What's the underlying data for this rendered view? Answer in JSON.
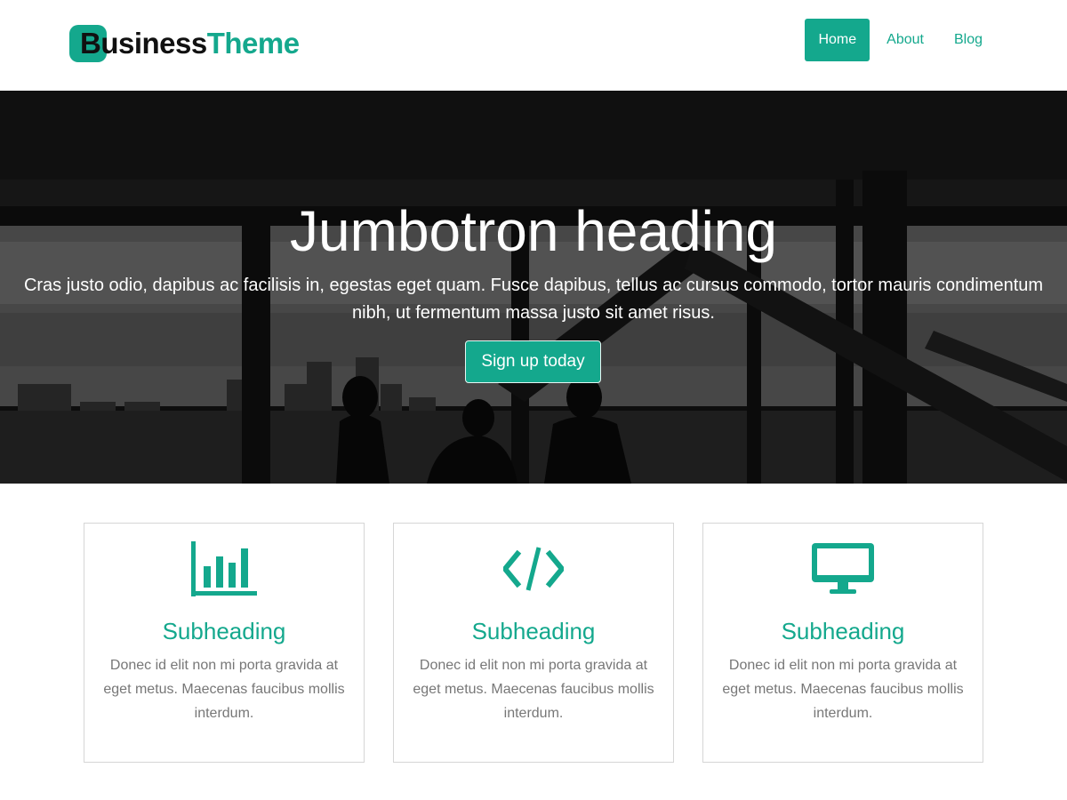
{
  "header": {
    "logo": {
      "part1": "Business",
      "part2": "Theme"
    },
    "nav": [
      {
        "label": "Home",
        "active": true
      },
      {
        "label": "About",
        "active": false
      },
      {
        "label": "Blog",
        "active": false
      }
    ]
  },
  "hero": {
    "title": "Jumbotron heading",
    "lead": "Cras justo odio, dapibus ac facilisis in, egestas eget quam. Fusce dapibus, tellus ac cursus commodo, tortor mauris condimentum nibh, ut fermentum massa justo sit amet risus.",
    "button_label": "Sign up today",
    "background": "grayscale office interior with city skyline and silhouettes of people"
  },
  "features": [
    {
      "icon": "bar-chart-icon",
      "title": "Subheading",
      "text": "Donec id elit non mi porta gravida at eget metus. Maecenas faucibus mollis interdum."
    },
    {
      "icon": "code-icon",
      "title": "Subheading",
      "text": "Donec id elit non mi porta gravida at eget metus. Maecenas faucibus mollis interdum."
    },
    {
      "icon": "desktop-icon",
      "title": "Subheading",
      "text": "Donec id elit non mi porta gravida at eget metus. Maecenas faucibus mollis interdum."
    }
  ],
  "colors": {
    "accent": "#14a88d",
    "hero_overlay": "#151515",
    "card_text": "#777777",
    "card_border": "#d6d6d6"
  }
}
